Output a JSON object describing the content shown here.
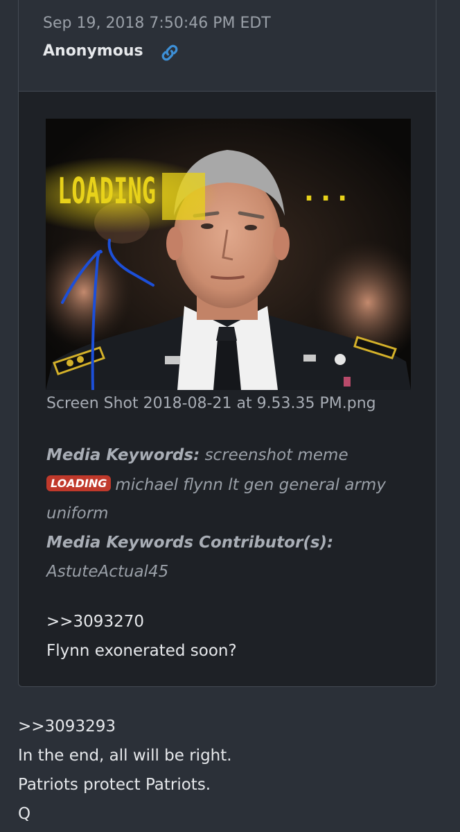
{
  "post": {
    "timestamp": "Sep 19, 2018 7:50:46 PM EDT",
    "author": "Anonymous",
    "link_icon": "link-icon",
    "image": {
      "overlay_text": "LOADING",
      "overlay_dots": "...",
      "caption": "Screen Shot 2018-08-21 at 9.53.35 PM.png"
    },
    "media_keywords": {
      "label": "Media Keywords:",
      "line1": "screenshot meme",
      "badge": "LOADING",
      "line2": "michael flynn lt gen general army",
      "line3": "uniform",
      "contributor_label": "Media Keywords Contributor(s):",
      "contributor": "AstuteActual45"
    },
    "reference": ">>3093270",
    "message": "Flynn exonerated soon?"
  },
  "reply": {
    "reference": ">>3093293",
    "lines": [
      "In the end, all will be right.",
      "Patriots protect Patriots.",
      "Q"
    ]
  },
  "colors": {
    "page_bg": "#2b3038",
    "card_bg": "#1e2126",
    "link_blue": "#3d8fd6",
    "badge_red": "#c0392b",
    "overlay_yellow": "#e8d21a"
  }
}
